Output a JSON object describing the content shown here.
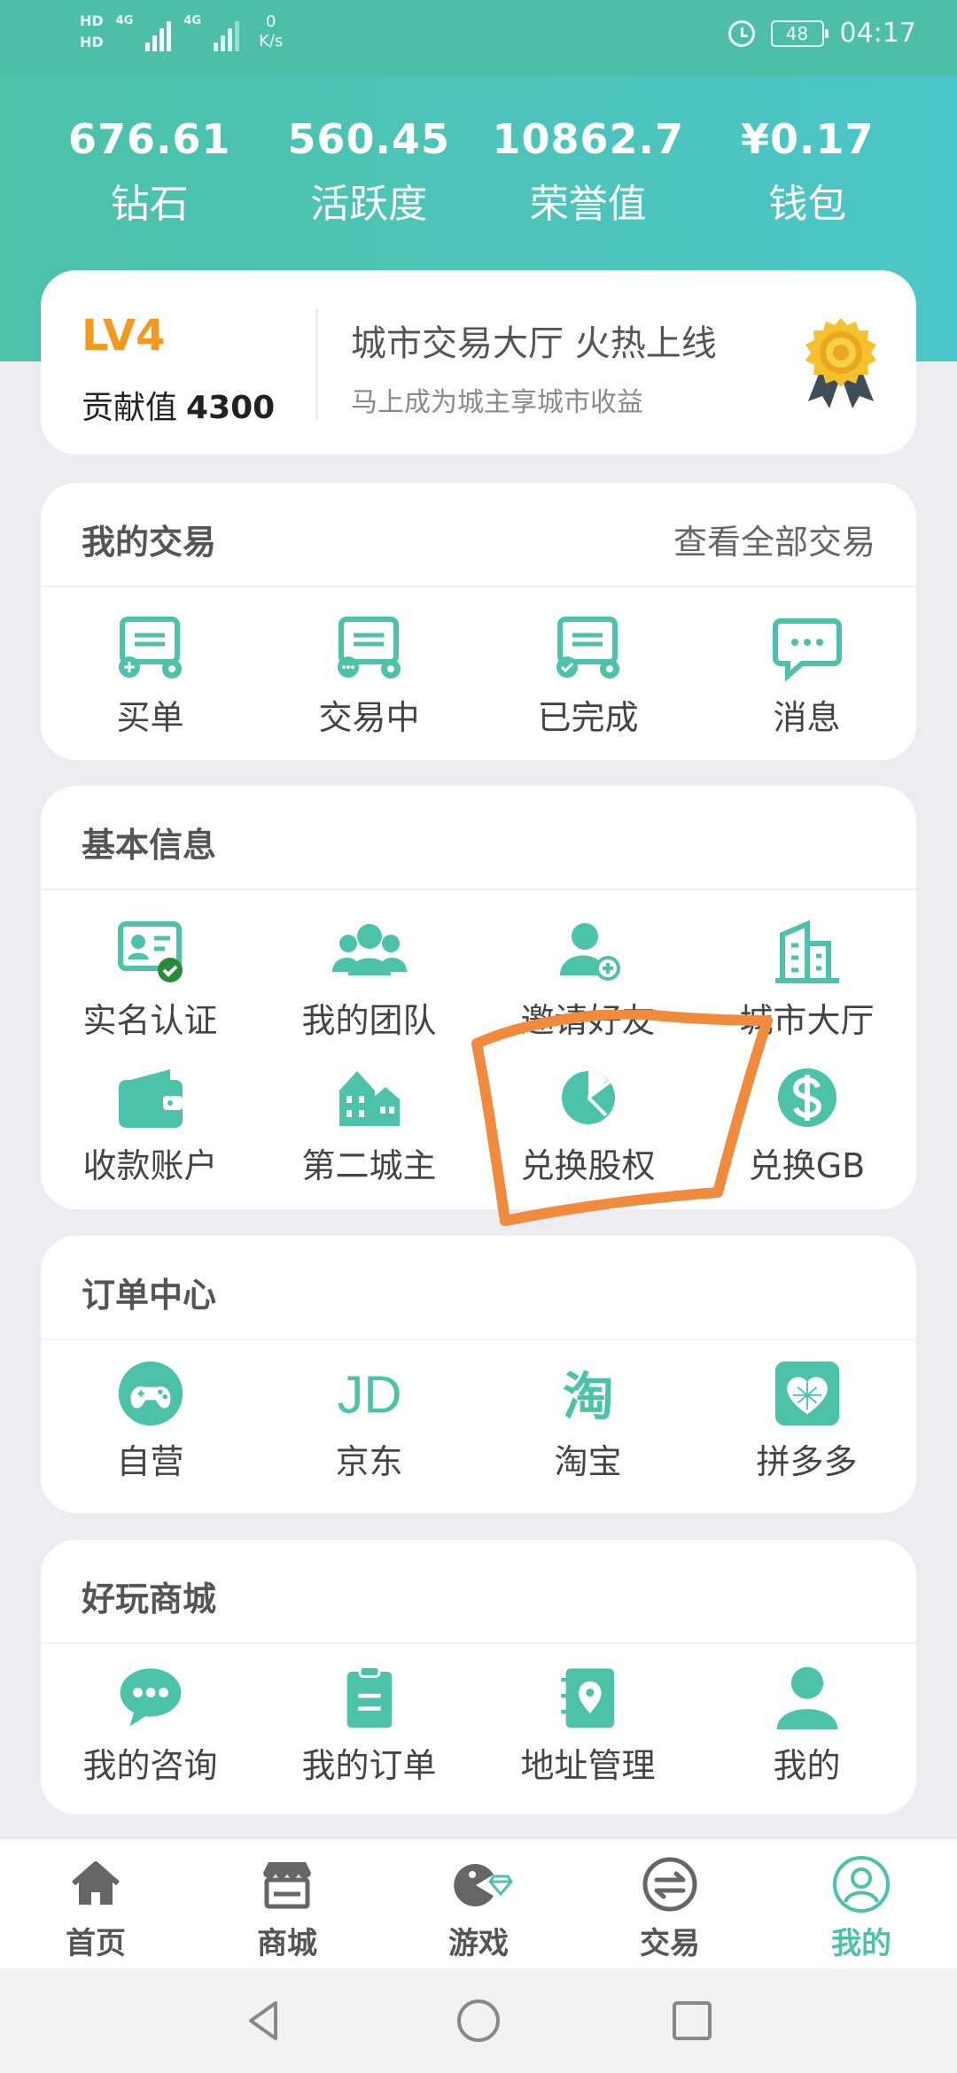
{
  "status_bar": {
    "hd1": "HD",
    "hd2": "HD",
    "net1": "4G",
    "net2": "4G",
    "speed_value": "0",
    "speed_unit": "K/s",
    "battery": "48",
    "time": "04:17"
  },
  "stats": [
    {
      "value": "676.61",
      "label": "钻石"
    },
    {
      "value": "560.45",
      "label": "活跃度"
    },
    {
      "value": "10862.7",
      "label": "荣誉值"
    },
    {
      "value": "¥0.17",
      "label": "钱包"
    }
  ],
  "level": {
    "level": "LV4",
    "contrib_label": "贡献值",
    "contrib_value": "4300",
    "promo_title": "城市交易大厅 火热上线",
    "promo_sub": "马上成为城主享城市收益"
  },
  "trade": {
    "title": "我的交易",
    "view_all": "查看全部交易",
    "items": [
      {
        "label": "买单",
        "icon": "buy-order-icon"
      },
      {
        "label": "交易中",
        "icon": "trading-icon"
      },
      {
        "label": "已完成",
        "icon": "completed-icon"
      },
      {
        "label": "消息",
        "icon": "message-icon"
      }
    ]
  },
  "basic": {
    "title": "基本信息",
    "items": [
      {
        "label": "实名认证",
        "icon": "id-verify-icon"
      },
      {
        "label": "我的团队",
        "icon": "team-icon"
      },
      {
        "label": "邀请好友",
        "icon": "invite-friend-icon"
      },
      {
        "label": "城市大厅",
        "icon": "city-hall-icon"
      },
      {
        "label": "收款账户",
        "icon": "wallet-icon"
      },
      {
        "label": "第二城主",
        "icon": "houses-icon"
      },
      {
        "label": "兑换股权",
        "icon": "pie-chart-icon"
      },
      {
        "label": "兑换GB",
        "icon": "dollar-icon"
      }
    ]
  },
  "orders": {
    "title": "订单中心",
    "items": [
      {
        "label": "自营",
        "icon": "gamepad-icon"
      },
      {
        "label": "京东",
        "icon": "jd-icon"
      },
      {
        "label": "淘宝",
        "icon": "taobao-icon"
      },
      {
        "label": "拼多多",
        "icon": "pinduoduo-icon"
      }
    ],
    "jd_text": "JD",
    "taobao_text": "淘"
  },
  "fun": {
    "title": "好玩商城",
    "items": [
      {
        "label": "我的咨询",
        "icon": "chat-icon"
      },
      {
        "label": "我的订单",
        "icon": "clipboard-icon"
      },
      {
        "label": "地址管理",
        "icon": "location-book-icon"
      },
      {
        "label": "我的",
        "icon": "person-icon"
      }
    ]
  },
  "tabs": [
    {
      "label": "首页",
      "icon": "home-icon"
    },
    {
      "label": "商城",
      "icon": "store-icon"
    },
    {
      "label": "游戏",
      "icon": "game-icon"
    },
    {
      "label": "交易",
      "icon": "exchange-icon"
    },
    {
      "label": "我的",
      "icon": "profile-icon",
      "active": true
    }
  ],
  "colors": {
    "accent": "#4cc2a9",
    "level": "#f39a1e",
    "highlight": "#f08a3c"
  }
}
